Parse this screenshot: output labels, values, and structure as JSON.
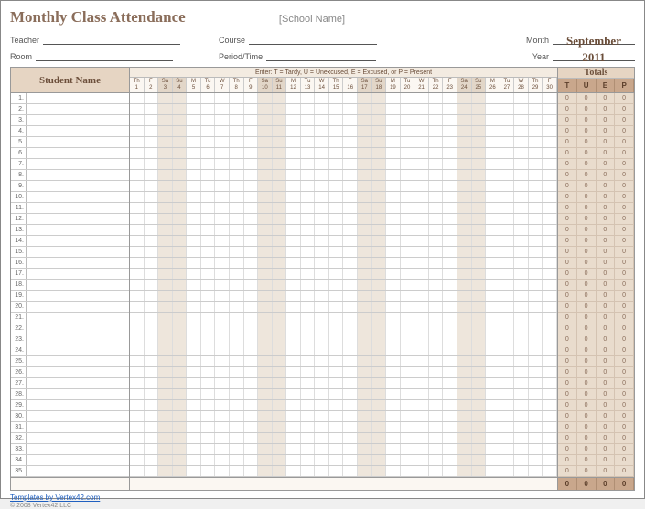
{
  "title": "Monthly Class Attendance",
  "school_placeholder": "[School Name]",
  "fields": {
    "teacher_label": "Teacher",
    "teacher_value": "",
    "course_label": "Course",
    "course_value": "",
    "month_label": "Month",
    "month_value": "September",
    "room_label": "Room",
    "room_value": "",
    "period_label": "Period/Time",
    "period_value": "",
    "year_label": "Year",
    "year_value": "2011"
  },
  "legend": "Enter:  T = Tardy,   U = Unexcused,   E = Excused,  or P = Present",
  "student_name_header": "Student Name",
  "totals_header": "Totals",
  "total_cols": [
    "T",
    "U",
    "E",
    "P"
  ],
  "days": [
    {
      "dow": "Th",
      "num": 1,
      "weekend": false
    },
    {
      "dow": "F",
      "num": 2,
      "weekend": false
    },
    {
      "dow": "Sa",
      "num": 3,
      "weekend": true
    },
    {
      "dow": "Su",
      "num": 4,
      "weekend": true
    },
    {
      "dow": "M",
      "num": 5,
      "weekend": false
    },
    {
      "dow": "Tu",
      "num": 6,
      "weekend": false
    },
    {
      "dow": "W",
      "num": 7,
      "weekend": false
    },
    {
      "dow": "Th",
      "num": 8,
      "weekend": false
    },
    {
      "dow": "F",
      "num": 9,
      "weekend": false
    },
    {
      "dow": "Sa",
      "num": 10,
      "weekend": true
    },
    {
      "dow": "Su",
      "num": 11,
      "weekend": true
    },
    {
      "dow": "M",
      "num": 12,
      "weekend": false
    },
    {
      "dow": "Tu",
      "num": 13,
      "weekend": false
    },
    {
      "dow": "W",
      "num": 14,
      "weekend": false
    },
    {
      "dow": "Th",
      "num": 15,
      "weekend": false
    },
    {
      "dow": "F",
      "num": 16,
      "weekend": false
    },
    {
      "dow": "Sa",
      "num": 17,
      "weekend": true
    },
    {
      "dow": "Su",
      "num": 18,
      "weekend": true
    },
    {
      "dow": "M",
      "num": 19,
      "weekend": false
    },
    {
      "dow": "Tu",
      "num": 20,
      "weekend": false
    },
    {
      "dow": "W",
      "num": 21,
      "weekend": false
    },
    {
      "dow": "Th",
      "num": 22,
      "weekend": false
    },
    {
      "dow": "F",
      "num": 23,
      "weekend": false
    },
    {
      "dow": "Sa",
      "num": 24,
      "weekend": true
    },
    {
      "dow": "Su",
      "num": 25,
      "weekend": true
    },
    {
      "dow": "M",
      "num": 26,
      "weekend": false
    },
    {
      "dow": "Tu",
      "num": 27,
      "weekend": false
    },
    {
      "dow": "W",
      "num": 28,
      "weekend": false
    },
    {
      "dow": "Th",
      "num": 29,
      "weekend": false
    },
    {
      "dow": "F",
      "num": 30,
      "weekend": false
    }
  ],
  "rows": 35,
  "row_totals_default": {
    "T": 0,
    "U": 0,
    "E": 0,
    "P": 0
  },
  "grand_totals": {
    "T": 0,
    "U": 0,
    "E": 0,
    "P": 0
  },
  "footer_link": "Templates by Vertex42.com",
  "copyright": "© 2008 Vertex42 LLC"
}
